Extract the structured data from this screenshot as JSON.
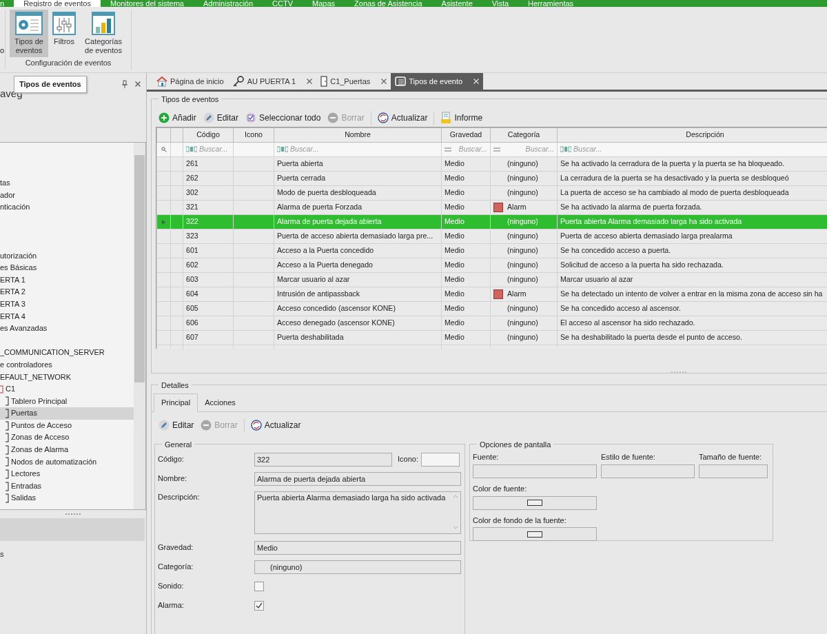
{
  "menu_bar": [
    {
      "label": "n",
      "selected": false
    },
    {
      "label": "Registro de eventos",
      "selected": true
    },
    {
      "label": "Monitores del sistema",
      "selected": false
    },
    {
      "label": "Administración",
      "selected": false
    },
    {
      "label": "CCTV",
      "selected": false
    },
    {
      "label": "Mapas",
      "selected": false
    },
    {
      "label": "Zonas de Asistencia",
      "selected": false
    },
    {
      "label": "Asistente",
      "selected": false
    },
    {
      "label": "Vista",
      "selected": false
    },
    {
      "label": "Herramientas",
      "selected": false
    }
  ],
  "ribbon": {
    "cut_label": "o",
    "group_label": "Configuración de eventos",
    "buttons": [
      {
        "label": "Tipos de eventos",
        "selected": true
      },
      {
        "label": "Filtros",
        "selected": false
      },
      {
        "label": "Categorías de eventos",
        "selected": false
      }
    ]
  },
  "tooltip": "Tipos de eventos",
  "nav_panel": {
    "title": "aveg",
    "footer_text": "s",
    "tree": [
      {
        "label": "tas",
        "selected": false
      },
      {
        "label": "ador",
        "selected": false
      },
      {
        "label": "nticación",
        "selected": false
      },
      {
        "selected": false
      },
      {
        "selected": false
      },
      {
        "selected": false
      },
      {
        "label": "utorización",
        "selected": false
      },
      {
        "label": "es Básicas",
        "selected": false
      },
      {
        "label": "ERTA 1",
        "selected": false
      },
      {
        "label": "ERTA 2",
        "selected": false
      },
      {
        "label": "ERTA 3",
        "selected": false
      },
      {
        "label": "ERTA 4",
        "selected": false
      },
      {
        "label": "es Avanzadas",
        "selected": false
      },
      {
        "selected": false
      },
      {
        "label": "_COMMUNICATION_SERVER",
        "selected": false
      },
      {
        "label": "e controladores",
        "selected": false
      },
      {
        "label": "EFAULT_NETWORK",
        "selected": false
      },
      {
        "label": "C1",
        "selected": false,
        "children": [
          {
            "label": "Tablero Principal",
            "selected": false
          },
          {
            "label": "Puertas",
            "selected": true
          },
          {
            "label": "Puntos de Acceso",
            "selected": false
          },
          {
            "label": "Zonas de Acceso",
            "selected": false
          },
          {
            "label": "Zonas de Alarma",
            "selected": false
          },
          {
            "label": "Nodos de automatización",
            "selected": false
          },
          {
            "label": "Lectores",
            "selected": false
          },
          {
            "label": "Entradas",
            "selected": false
          },
          {
            "label": "Salidas",
            "selected": false
          }
        ]
      }
    ]
  },
  "doc_tabs": [
    {
      "label": "Página de inicio",
      "closable": false,
      "selected": false
    },
    {
      "label": "AU PUERTA 1",
      "closable": true,
      "selected": false
    },
    {
      "label": "C1_Puertas",
      "closable": true,
      "selected": false
    },
    {
      "label": "Tipos de evento",
      "closable": true,
      "selected": true
    }
  ],
  "events_group": {
    "title": "Tipos de eventos",
    "toolbar": [
      {
        "label": "Añadir",
        "disabled": false
      },
      {
        "label": "Editar",
        "disabled": false
      },
      {
        "label": "Seleccionar todo",
        "disabled": false
      },
      {
        "label": "Borrar",
        "disabled": true
      },
      {
        "label": "Actualizar",
        "disabled": false
      },
      {
        "label": "Informe",
        "disabled": false
      }
    ],
    "table": {
      "columns": [
        "Código",
        "Icono",
        "Nombre",
        "Gravedad",
        "Categoría",
        "Descripción"
      ],
      "filters": [
        {
          "kind": "text",
          "placeholder": "Buscar..."
        },
        {
          "kind": "none"
        },
        {
          "kind": "text",
          "placeholder": "Buscar..."
        },
        {
          "kind": "equals",
          "placeholder": "Buscar..."
        },
        {
          "kind": "equals",
          "placeholder": "Buscar..."
        },
        {
          "kind": "text",
          "placeholder": "Buscar..."
        }
      ],
      "rows": [
        {
          "code": "261",
          "name": "Puerta abierta",
          "severity": "Medio",
          "category": "(ninguno)",
          "description": "Se ha activado la cerradura de la puerta y la puerta se ha bloqueado.",
          "selected": false
        },
        {
          "code": "262",
          "name": "Puerta cerrada",
          "severity": "Medio",
          "category": "(ninguno)",
          "description": "La cerradura de la puerta se ha desactivado y la puerta se desbloqueó",
          "selected": false
        },
        {
          "code": "302",
          "name": "Modo de puerta desbloqueada",
          "severity": "Medio",
          "category": "(ninguno)",
          "description": "La puerta de acceso se ha cambiado al modo de puerta desbloqueada",
          "selected": false
        },
        {
          "code": "321",
          "name": "Alarma de puerta Forzada",
          "severity": "Medio",
          "category": "Alarm",
          "color": "#d0635c",
          "description": "Se ha activado la alarma de puerta forzada.",
          "selected": false
        },
        {
          "code": "322",
          "name": "Alarma de puerta dejada abierta",
          "severity": "Medio",
          "category": "(ninguno)",
          "description": "Puerta abierta Alarma demasiado larga ha sido activada",
          "selected": true
        },
        {
          "code": "323",
          "name": "Puerta de acceso abierta demasiado larga pre...",
          "severity": "Medio",
          "category": "(ninguno)",
          "description": "Puerta de acceso abierta demasiado larga prealarma",
          "selected": false
        },
        {
          "code": "601",
          "name": "Acceso a la Puerta concedido",
          "severity": "Medio",
          "category": "(ninguno)",
          "description": "Se ha concedido acceso a puerta.",
          "selected": false
        },
        {
          "code": "602",
          "name": "Acceso a la Puerta denegado",
          "severity": "Medio",
          "category": "(ninguno)",
          "description": "Solicitud de acceso a la puerta ha sido rechazada.",
          "selected": false
        },
        {
          "code": "603",
          "name": "Marcar usuario al azar",
          "severity": "Medio",
          "category": "(ninguno)",
          "description": "Marcar usuario al azar",
          "selected": false
        },
        {
          "code": "604",
          "name": "Intrusión de antipassback",
          "severity": "Medio",
          "category": "Alarm",
          "color": "#d0635c",
          "description": "Se ha detectado un intento de volver a entrar en la misma zona de acceso sin ha",
          "selected": false
        },
        {
          "code": "605",
          "name": "Acceso concedido (ascensor KONE)",
          "severity": "Medio",
          "category": "(ninguno)",
          "description": "Se ha concedido acceso al ascensor.",
          "selected": false
        },
        {
          "code": "606",
          "name": "Acceso denegado (ascensor KONE)",
          "severity": "Medio",
          "category": "(ninguno)",
          "description": "El acceso al ascensor ha sido rechazado.",
          "selected": false
        },
        {
          "code": "607",
          "name": "Puerta deshabilitada",
          "severity": "Medio",
          "category": "(ninguno)",
          "description": "Se ha deshabilitado la puerta desde el punto de acceso.",
          "selected": false
        }
      ]
    }
  },
  "details": {
    "title": "Detalles",
    "tabs": [
      {
        "label": "Principal",
        "selected": true
      },
      {
        "label": "Acciones",
        "selected": false
      }
    ],
    "toolbar": [
      {
        "label": "Editar",
        "disabled": false
      },
      {
        "label": "Borrar",
        "disabled": true
      },
      {
        "label": "Actualizar",
        "disabled": false
      }
    ],
    "general": {
      "title": "General",
      "fields": [
        {
          "kind": "code",
          "label": "Código:",
          "value": "322",
          "extra_label": "Icono:"
        },
        {
          "kind": "text",
          "label": "Nombre:",
          "value": "Alarma de puerta dejada abierta"
        },
        {
          "kind": "textarea",
          "label": "Descripción:",
          "value": "Puerta abierta Alarma demasiado larga ha sido activada"
        },
        {
          "kind": "text",
          "label": "Gravedad:",
          "value": "Medio"
        },
        {
          "kind": "category",
          "label": "Categoría:",
          "value": "(ninguno)"
        },
        {
          "kind": "checkbox",
          "label": "Sonido:",
          "checked": false
        },
        {
          "kind": "checkbox",
          "label": "Alarma:",
          "checked": true
        }
      ]
    },
    "display": {
      "title": "Opciones de pantalla",
      "font_fields": [
        "Fuente:",
        "Estilo de fuente:",
        "Tamaño de fuente:"
      ],
      "color_fields": [
        "Color de fuente:",
        "Color de fondo de la fuente:"
      ]
    }
  }
}
